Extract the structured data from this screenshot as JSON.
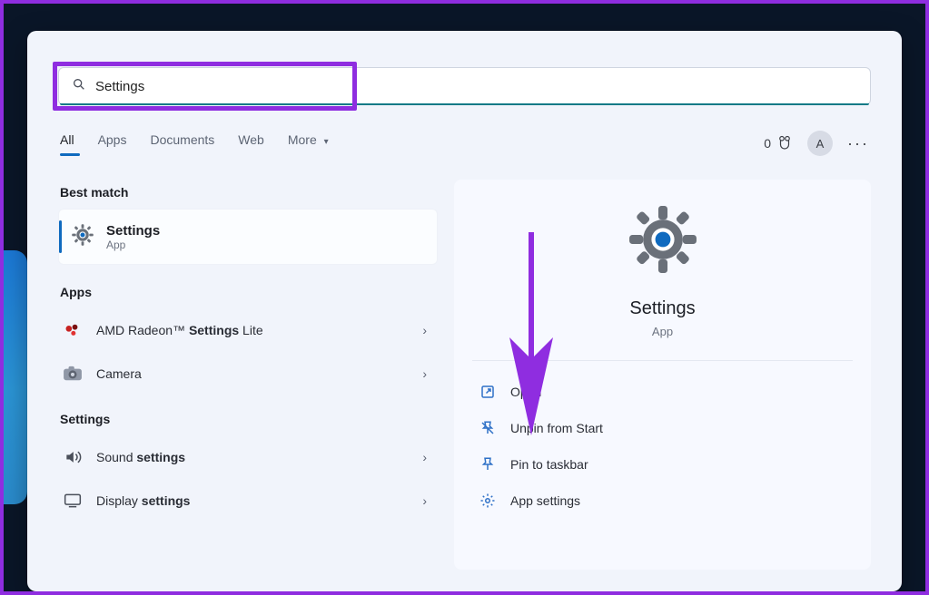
{
  "search": {
    "query": "Settings"
  },
  "filters": {
    "tabs": [
      "All",
      "Apps",
      "Documents",
      "Web",
      "More"
    ],
    "active_index": 0,
    "rewards_count": "0",
    "avatar_initial": "A"
  },
  "left": {
    "best_match_header": "Best match",
    "best_match": {
      "name": "Settings",
      "sub": "App"
    },
    "apps_header": "Apps",
    "apps": [
      {
        "prefix": "AMD Radeon™ ",
        "highlight": "Settings",
        "suffix": " Lite",
        "icon": "amd"
      },
      {
        "prefix": "",
        "highlight": "Camera",
        "suffix": "",
        "icon": "camera",
        "no_bold": true
      }
    ],
    "settings_header": "Settings",
    "settings": [
      {
        "prefix": "Sound ",
        "highlight": "settings",
        "suffix": "",
        "icon": "sound"
      },
      {
        "prefix": "Display ",
        "highlight": "settings",
        "suffix": "",
        "icon": "display"
      }
    ]
  },
  "right": {
    "title": "Settings",
    "sub": "App",
    "actions": [
      {
        "id": "open",
        "label": "Open"
      },
      {
        "id": "unpin",
        "label": "Unpin from Start"
      },
      {
        "id": "pin",
        "label": "Pin to taskbar"
      },
      {
        "id": "appsettings",
        "label": "App settings"
      }
    ]
  }
}
